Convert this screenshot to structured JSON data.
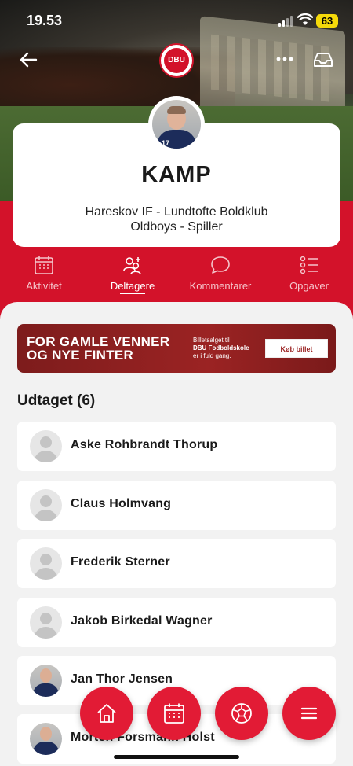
{
  "status_bar": {
    "time": "19.53",
    "battery": "63"
  },
  "club_logo": {
    "text": "DBU"
  },
  "event": {
    "title": "KAMP",
    "line1": "Hareskov IF - Lundtofte Boldklub",
    "line2": "Oldboys - Spiller"
  },
  "tabs": [
    {
      "label": "Aktivitet",
      "icon": "calendar-icon",
      "active": false
    },
    {
      "label": "Deltagere",
      "icon": "participants-icon",
      "active": true
    },
    {
      "label": "Kommentarer",
      "icon": "comment-icon",
      "active": false
    },
    {
      "label": "Opgaver",
      "icon": "tasks-icon",
      "active": false
    }
  ],
  "banner": {
    "line1": "FOR GAMLE VENNER",
    "line2": "OG NYE FINTER",
    "small1": "Billetsalget til",
    "small2": "DBU Fodboldskole",
    "small3": "er i fuld gang.",
    "button": "Køb billet"
  },
  "section": {
    "title": "Udtaget (6)"
  },
  "participants": [
    {
      "name": "Aske Rohbrandt Thorup",
      "avatar": "placeholder"
    },
    {
      "name": "Claus Holmvang",
      "avatar": "placeholder"
    },
    {
      "name": "Frederik Sterner",
      "avatar": "placeholder"
    },
    {
      "name": "Jakob Birkedal Wagner",
      "avatar": "placeholder"
    },
    {
      "name": "Jan Thor Jensen",
      "avatar": "photo"
    },
    {
      "name": "Morten Forsmann Holst",
      "avatar": "photo"
    }
  ],
  "bottom_actions": [
    "home-icon",
    "calendar-icon",
    "football-icon",
    "menu-icon"
  ],
  "colors": {
    "brand_red": "#d3122a",
    "fab_red": "#e21b35",
    "battery": "#f5d90a"
  }
}
